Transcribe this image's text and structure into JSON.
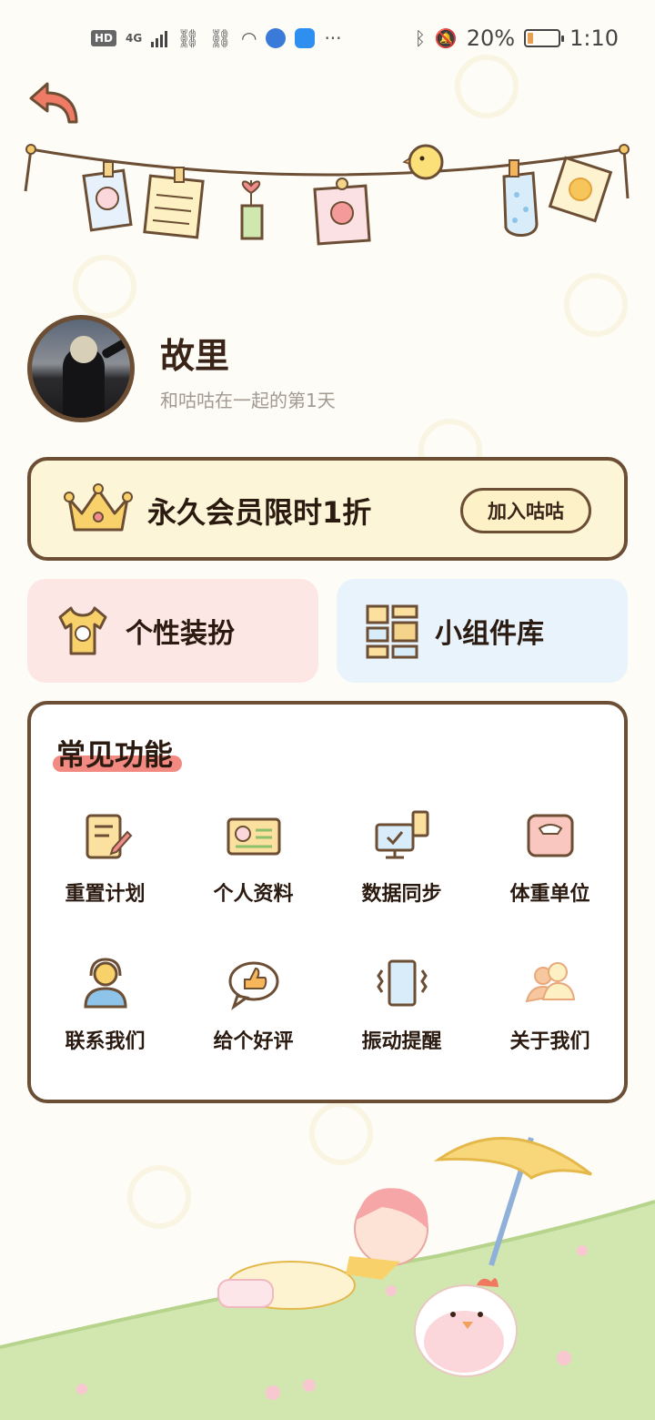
{
  "status_bar": {
    "network_badge": "HD",
    "network_type": "4G",
    "battery_percent": "20%",
    "time": "1:10",
    "more": "···"
  },
  "profile": {
    "name": "故里",
    "subtitle": "和咕咕在一起的第1天"
  },
  "vip": {
    "text": "永久会员限时1折",
    "button": "加入咕咕"
  },
  "features": [
    {
      "label": "个性装扮",
      "icon": "tshirt-icon"
    },
    {
      "label": "小组件库",
      "icon": "widget-icon"
    }
  ],
  "common": {
    "title": "常见功能",
    "items": [
      {
        "label": "重置计划",
        "icon": "document-icon"
      },
      {
        "label": "个人资料",
        "icon": "id-card-icon"
      },
      {
        "label": "数据同步",
        "icon": "monitor-sync-icon"
      },
      {
        "label": "体重单位",
        "icon": "scale-icon"
      },
      {
        "label": "联系我们",
        "icon": "headset-person-icon"
      },
      {
        "label": "给个好评",
        "icon": "thumbs-up-icon"
      },
      {
        "label": "振动提醒",
        "icon": "vibrate-phone-icon"
      },
      {
        "label": "关于我们",
        "icon": "people-icon"
      }
    ]
  },
  "colors": {
    "border": "#6b4e34",
    "vip_bg": "#fdf5d8",
    "dress_bg": "#fce7e5",
    "widget_bg": "#e8f3fc",
    "title_highlight": "#f28a82"
  }
}
